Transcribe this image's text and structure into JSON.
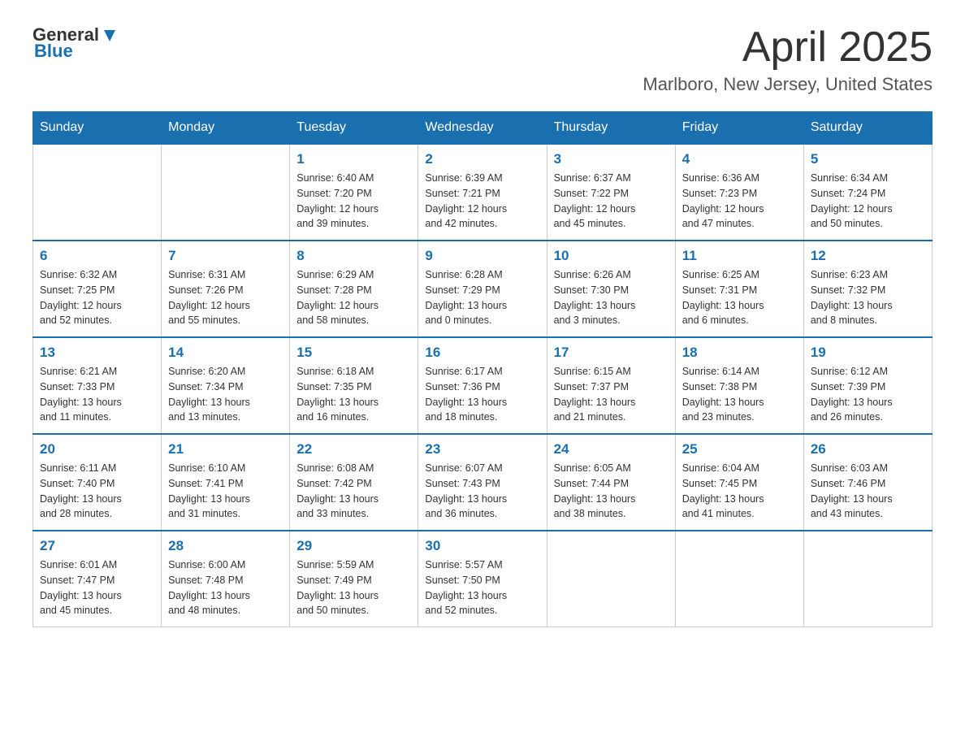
{
  "header": {
    "logo_general": "General",
    "logo_blue": "Blue",
    "title": "April 2025",
    "subtitle": "Marlboro, New Jersey, United States"
  },
  "days_of_week": [
    "Sunday",
    "Monday",
    "Tuesday",
    "Wednesday",
    "Thursday",
    "Friday",
    "Saturday"
  ],
  "weeks": [
    [
      {
        "day": "",
        "info": ""
      },
      {
        "day": "",
        "info": ""
      },
      {
        "day": "1",
        "info": "Sunrise: 6:40 AM\nSunset: 7:20 PM\nDaylight: 12 hours\nand 39 minutes."
      },
      {
        "day": "2",
        "info": "Sunrise: 6:39 AM\nSunset: 7:21 PM\nDaylight: 12 hours\nand 42 minutes."
      },
      {
        "day": "3",
        "info": "Sunrise: 6:37 AM\nSunset: 7:22 PM\nDaylight: 12 hours\nand 45 minutes."
      },
      {
        "day": "4",
        "info": "Sunrise: 6:36 AM\nSunset: 7:23 PM\nDaylight: 12 hours\nand 47 minutes."
      },
      {
        "day": "5",
        "info": "Sunrise: 6:34 AM\nSunset: 7:24 PM\nDaylight: 12 hours\nand 50 minutes."
      }
    ],
    [
      {
        "day": "6",
        "info": "Sunrise: 6:32 AM\nSunset: 7:25 PM\nDaylight: 12 hours\nand 52 minutes."
      },
      {
        "day": "7",
        "info": "Sunrise: 6:31 AM\nSunset: 7:26 PM\nDaylight: 12 hours\nand 55 minutes."
      },
      {
        "day": "8",
        "info": "Sunrise: 6:29 AM\nSunset: 7:28 PM\nDaylight: 12 hours\nand 58 minutes."
      },
      {
        "day": "9",
        "info": "Sunrise: 6:28 AM\nSunset: 7:29 PM\nDaylight: 13 hours\nand 0 minutes."
      },
      {
        "day": "10",
        "info": "Sunrise: 6:26 AM\nSunset: 7:30 PM\nDaylight: 13 hours\nand 3 minutes."
      },
      {
        "day": "11",
        "info": "Sunrise: 6:25 AM\nSunset: 7:31 PM\nDaylight: 13 hours\nand 6 minutes."
      },
      {
        "day": "12",
        "info": "Sunrise: 6:23 AM\nSunset: 7:32 PM\nDaylight: 13 hours\nand 8 minutes."
      }
    ],
    [
      {
        "day": "13",
        "info": "Sunrise: 6:21 AM\nSunset: 7:33 PM\nDaylight: 13 hours\nand 11 minutes."
      },
      {
        "day": "14",
        "info": "Sunrise: 6:20 AM\nSunset: 7:34 PM\nDaylight: 13 hours\nand 13 minutes."
      },
      {
        "day": "15",
        "info": "Sunrise: 6:18 AM\nSunset: 7:35 PM\nDaylight: 13 hours\nand 16 minutes."
      },
      {
        "day": "16",
        "info": "Sunrise: 6:17 AM\nSunset: 7:36 PM\nDaylight: 13 hours\nand 18 minutes."
      },
      {
        "day": "17",
        "info": "Sunrise: 6:15 AM\nSunset: 7:37 PM\nDaylight: 13 hours\nand 21 minutes."
      },
      {
        "day": "18",
        "info": "Sunrise: 6:14 AM\nSunset: 7:38 PM\nDaylight: 13 hours\nand 23 minutes."
      },
      {
        "day": "19",
        "info": "Sunrise: 6:12 AM\nSunset: 7:39 PM\nDaylight: 13 hours\nand 26 minutes."
      }
    ],
    [
      {
        "day": "20",
        "info": "Sunrise: 6:11 AM\nSunset: 7:40 PM\nDaylight: 13 hours\nand 28 minutes."
      },
      {
        "day": "21",
        "info": "Sunrise: 6:10 AM\nSunset: 7:41 PM\nDaylight: 13 hours\nand 31 minutes."
      },
      {
        "day": "22",
        "info": "Sunrise: 6:08 AM\nSunset: 7:42 PM\nDaylight: 13 hours\nand 33 minutes."
      },
      {
        "day": "23",
        "info": "Sunrise: 6:07 AM\nSunset: 7:43 PM\nDaylight: 13 hours\nand 36 minutes."
      },
      {
        "day": "24",
        "info": "Sunrise: 6:05 AM\nSunset: 7:44 PM\nDaylight: 13 hours\nand 38 minutes."
      },
      {
        "day": "25",
        "info": "Sunrise: 6:04 AM\nSunset: 7:45 PM\nDaylight: 13 hours\nand 41 minutes."
      },
      {
        "day": "26",
        "info": "Sunrise: 6:03 AM\nSunset: 7:46 PM\nDaylight: 13 hours\nand 43 minutes."
      }
    ],
    [
      {
        "day": "27",
        "info": "Sunrise: 6:01 AM\nSunset: 7:47 PM\nDaylight: 13 hours\nand 45 minutes."
      },
      {
        "day": "28",
        "info": "Sunrise: 6:00 AM\nSunset: 7:48 PM\nDaylight: 13 hours\nand 48 minutes."
      },
      {
        "day": "29",
        "info": "Sunrise: 5:59 AM\nSunset: 7:49 PM\nDaylight: 13 hours\nand 50 minutes."
      },
      {
        "day": "30",
        "info": "Sunrise: 5:57 AM\nSunset: 7:50 PM\nDaylight: 13 hours\nand 52 minutes."
      },
      {
        "day": "",
        "info": ""
      },
      {
        "day": "",
        "info": ""
      },
      {
        "day": "",
        "info": ""
      }
    ]
  ]
}
